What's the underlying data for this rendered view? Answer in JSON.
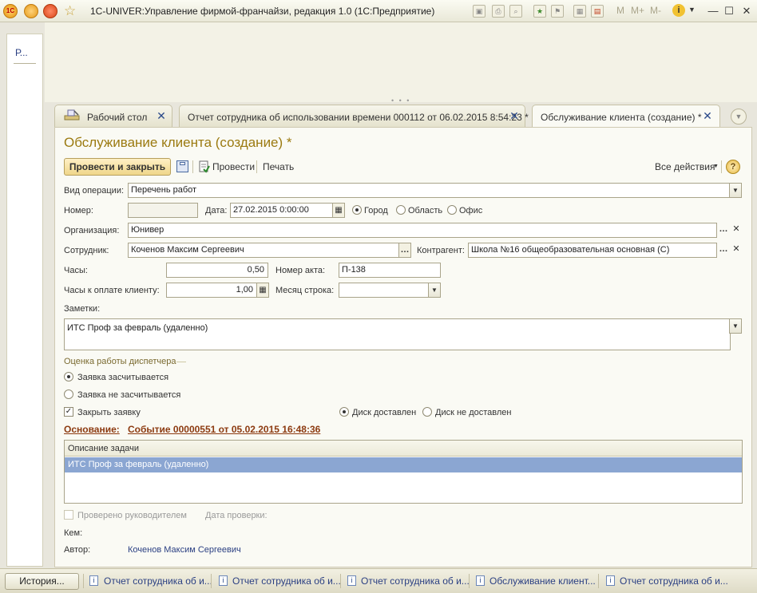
{
  "window": {
    "title": "1С-UNIVER:Управление фирмой-франчайзи, редакция 1.0  (1С:Предприятие)",
    "toolbar_texts": [
      "M",
      "M+",
      "M-"
    ]
  },
  "left_panel": {
    "item_label": "Р..."
  },
  "tabs": [
    {
      "label": "Рабочий стол"
    },
    {
      "label": "Отчет сотрудника об использовании времени 000112 от 06.02.2015 8:54:23 *"
    },
    {
      "label": "Обслуживание клиента (создание) *"
    }
  ],
  "form": {
    "title": "Обслуживание клиента (создание) *",
    "toolbar": {
      "post_close": "Провести и закрыть",
      "post": "Провести",
      "print": "Печать",
      "all_actions": "Все действия"
    },
    "fields": {
      "operation_type_label": "Вид операции:",
      "operation_type_value": "Перечень работ",
      "number_label": "Номер:",
      "number_value": "",
      "date_label": "Дата:",
      "date_value": "27.02.2015  0:00:00",
      "radio_city": "Город",
      "radio_region": "Область",
      "radio_office": "Офис",
      "organization_label": "Организация:",
      "organization_value": "Юнивер",
      "employee_label": "Сотрудник:",
      "employee_value": "Коченов Максим Сергеевич",
      "counterparty_label": "Контрагент:",
      "counterparty_value": "Школа №16 общеобразовательная основная (С)",
      "hours_label": "Часы:",
      "hours_value": "0,50",
      "act_number_label": "Номер акта:",
      "act_number_value": "П-138",
      "billable_hours_label": "Часы к оплате клиенту:",
      "billable_hours_value": "1,00",
      "month_row_label": "Месяц строка:",
      "month_row_value": "",
      "notes_label": "Заметки:",
      "notes_value": "ИТС Проф за февраль (удаленно)"
    },
    "dispatcher": {
      "section_title": "Оценка работы диспетчера",
      "counted": "Заявка засчитывается",
      "not_counted": "Заявка не засчитывается",
      "close_request": "Закрыть заявку",
      "disk_delivered": "Диск доставлен",
      "disk_not_delivered": "Диск не доставлен"
    },
    "basis": {
      "label": "Основание:",
      "link": "Событие 00000551 от 05.02.2015 16:48:36"
    },
    "task_table": {
      "header": "Описание задачи",
      "rows": [
        "ИТС Проф за февраль (удаленно)"
      ]
    },
    "footer": {
      "checked_by_manager": "Проверено руководителем",
      "check_date_label": "Дата проверки:",
      "by_whom_label": "Кем:",
      "author_label": "Автор:",
      "author_value": "Коченов Максим Сергеевич"
    }
  },
  "taskbar": {
    "history": "История...",
    "items": [
      "Отчет сотрудника об и...",
      "Отчет сотрудника об и...",
      "Отчет сотрудника об и...",
      "Обслуживание клиент...",
      "Отчет сотрудника об и..."
    ]
  },
  "colors": {
    "accent_title": "#9b7a10",
    "link": "#8c3a10",
    "selected_row": "#8ba6d2",
    "nav_blue": "#2a3f82"
  }
}
